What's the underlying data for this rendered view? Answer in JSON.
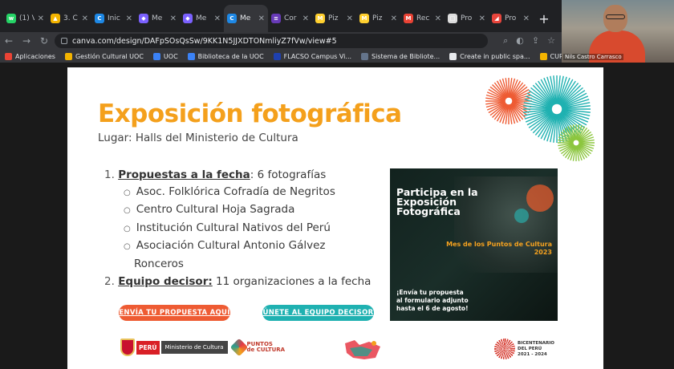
{
  "browser": {
    "tabs": [
      {
        "label": "(1) V",
        "icon": "whatsapp-icon",
        "color": "#25d366",
        "glyph": "w"
      },
      {
        "label": "3. C",
        "icon": "drive-icon",
        "color": "#f4b400",
        "glyph": "▲"
      },
      {
        "label": "Inic",
        "icon": "canva-icon",
        "color": "#1e88e5",
        "glyph": "C"
      },
      {
        "label": "Me",
        "icon": "form-icon",
        "color": "#7b61ff",
        "glyph": "◆"
      },
      {
        "label": "Me",
        "icon": "form-icon",
        "color": "#7b61ff",
        "glyph": "◆"
      },
      {
        "label": "Me",
        "icon": "canva-icon",
        "color": "#1e88e5",
        "glyph": "C",
        "active": true
      },
      {
        "label": "Cor",
        "icon": "forms-icon",
        "color": "#673ab7",
        "glyph": "≡"
      },
      {
        "label": "Piz",
        "icon": "miro-icon",
        "color": "#ffd02f",
        "glyph": "M"
      },
      {
        "label": "Piz",
        "icon": "miro-icon",
        "color": "#ffd02f",
        "glyph": "M"
      },
      {
        "label": "Rec",
        "icon": "gmail-icon",
        "color": "#ea4335",
        "glyph": "M"
      },
      {
        "label": "Pro",
        "icon": "doc-icon",
        "color": "#dddddd",
        "glyph": "□"
      },
      {
        "label": "Pro",
        "icon": "pdf-icon",
        "color": "#e8453c",
        "glyph": "◢"
      }
    ],
    "new_tab": "+",
    "url": "canva.com/design/DAFpSOsQsSw/9KK1N5JJXDTONmliyZ7fVw/view#5",
    "bookmarks": [
      {
        "label": "Aplicaciones",
        "color": "#ea4335"
      },
      {
        "label": "Gestión Cultural UOC",
        "color": "#f4b400"
      },
      {
        "label": "UOC",
        "color": "#3b82f6"
      },
      {
        "label": "Biblioteca de la UOC",
        "color": "#3b82f6"
      },
      {
        "label": "FLACSO Campus Vi...",
        "color": "#1e40af"
      },
      {
        "label": "Sistema de Bibliote...",
        "color": "#64748b"
      },
      {
        "label": "Create in public spa...",
        "color": "#e8eaed"
      },
      {
        "label": "CURSOS // MASTER",
        "color": "#f4b400"
      }
    ],
    "video_name": "Nils Castro Carrasco"
  },
  "slide": {
    "title": "Exposición fotográfica",
    "subtitle": "Lugar: Halls del Ministerio de Cultura",
    "item1_num": "1.",
    "item1_key": "Propuestas a la fecha",
    "item1_rest": ": 6 fotografías",
    "subitems": [
      "Asoc. Folklórica Cofradía de Negritos",
      "Centro Cultural Hoja Sagrada",
      "Institución Cultural Nativos del Perú",
      "Asociación Cultural Antonio Gálvez"
    ],
    "subitem_cont": "Ronceros",
    "item2_num": "2.",
    "item2_key": "Equipo decisor:",
    "item2_rest": " 11 organizaciones a la fecha",
    "btn_propuesta": "ENVÍA TU PROPUESTA AQUÍ",
    "btn_equipo": "ÚNETE AL EQUIPO DECISOR",
    "poster": {
      "title_lines": [
        "Participa en la",
        "Exposición",
        "Fotográfica"
      ],
      "mes_lines": [
        "Mes de los Puntos de Cultura",
        "2023"
      ],
      "foot_lines": [
        "¡Envía tu propuesta",
        "al formulario adjunto",
        "hasta el 6 de agosto!"
      ]
    },
    "logos": {
      "peru": "PERÚ",
      "ministerio": "Ministerio de Cultura",
      "puntos_lines": [
        "PUNTOS",
        "de CULTURA"
      ],
      "bicentenario_lines": [
        "BICENTENARIO",
        "DEL PERÚ",
        "2021 - 2024"
      ]
    },
    "colors": {
      "title": "#f4a01c",
      "btn_propuesta": "#ee5b33",
      "btn_equipo": "#1fb1b1"
    }
  }
}
